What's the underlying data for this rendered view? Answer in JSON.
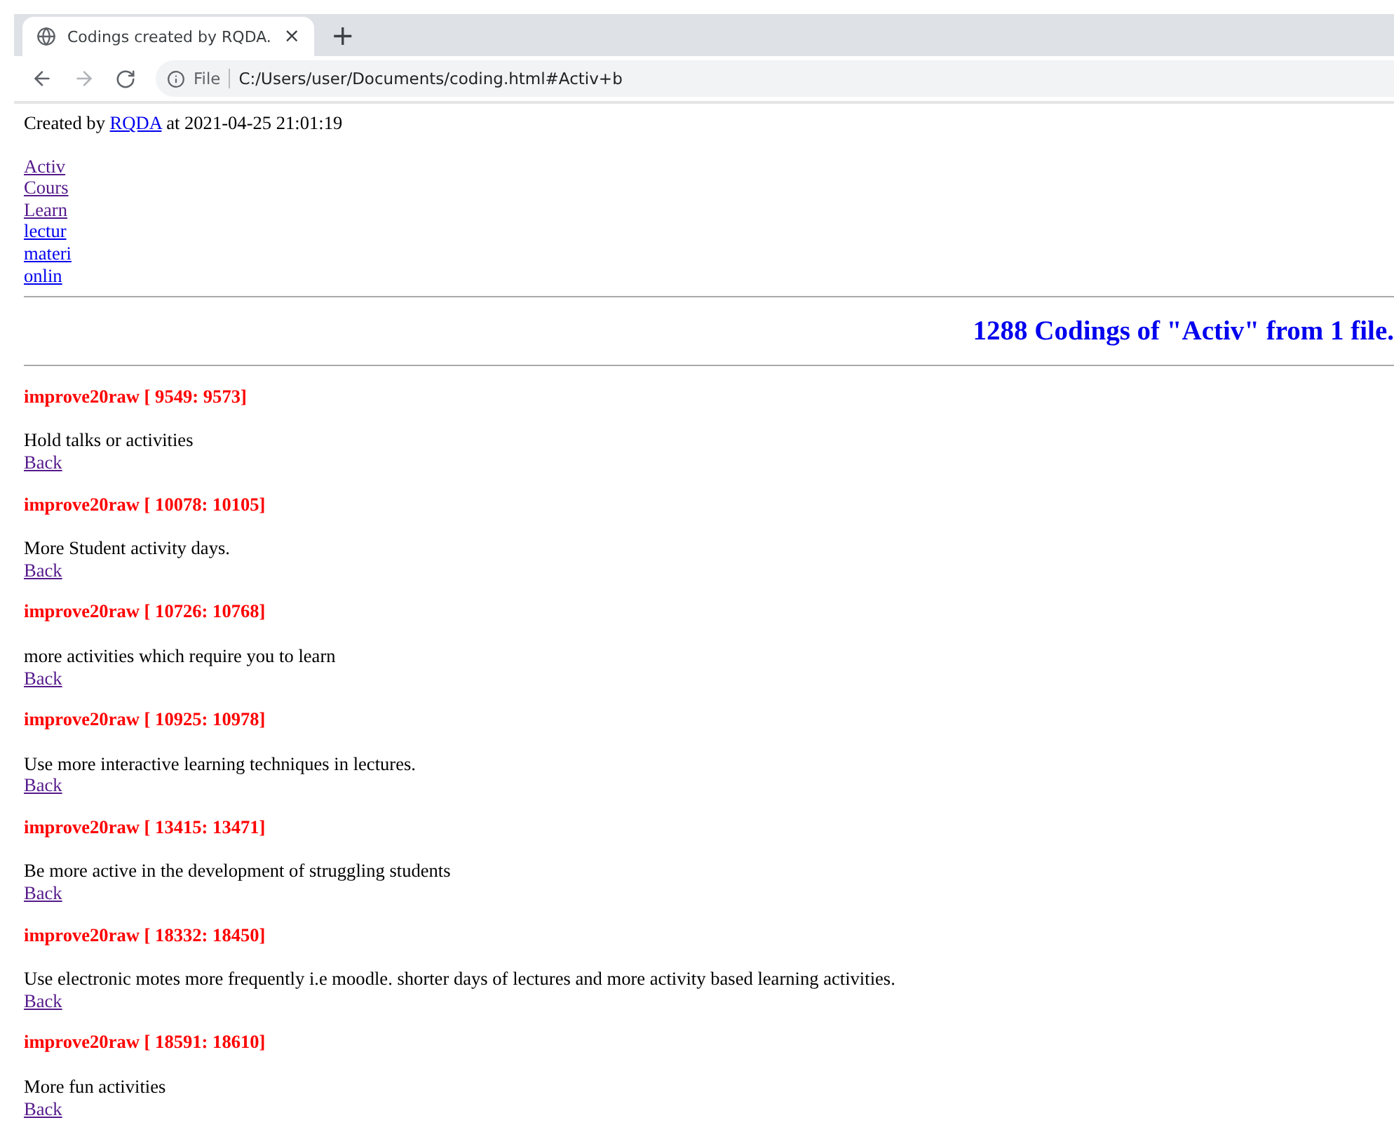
{
  "browser": {
    "tab_title": "Codings created by RQDA.",
    "tab_close": "×",
    "new_tab": "+",
    "url_scheme": "File",
    "url": "C:/Users/user/Documents/coding.html#Activ+b"
  },
  "header": {
    "prefix": "Created by",
    "link": "RQDA",
    "suffix": "at 2021-04-25 21:01:19"
  },
  "code_links": [
    {
      "label": "Activ",
      "visited": true
    },
    {
      "label": "Cours",
      "visited": true
    },
    {
      "label": "Learn",
      "visited": true
    },
    {
      "label": "lectur",
      "visited": false
    },
    {
      "label": "materi",
      "visited": false
    },
    {
      "label": "onlin",
      "visited": false
    }
  ],
  "heading": "1288 Codings of \"Activ\" from 1 file.",
  "codings": [
    {
      "source": "improve20raw [ 9549: 9573]",
      "text": "Hold talks or activities",
      "back": "Back"
    },
    {
      "source": "improve20raw [ 10078: 10105]",
      "text": "More Student activity days.",
      "back": "Back"
    },
    {
      "source": "improve20raw [ 10726: 10768]",
      "text": "more activities which require you to learn",
      "back": "Back"
    },
    {
      "source": "improve20raw [ 10925: 10978]",
      "text": "Use more interactive learning techniques in lectures.",
      "back": "Back"
    },
    {
      "source": "improve20raw [ 13415: 13471]",
      "text": "Be more active in the development of struggling students",
      "back": "Back"
    },
    {
      "source": "improve20raw [ 18332: 18450]",
      "text": "Use electronic motes more frequently i.e moodle. shorter days of lectures and more activity based learning activities.",
      "back": "Back"
    },
    {
      "source": "improve20raw [ 18591: 18610]",
      "text": "More fun activities",
      "back": "Back"
    }
  ]
}
